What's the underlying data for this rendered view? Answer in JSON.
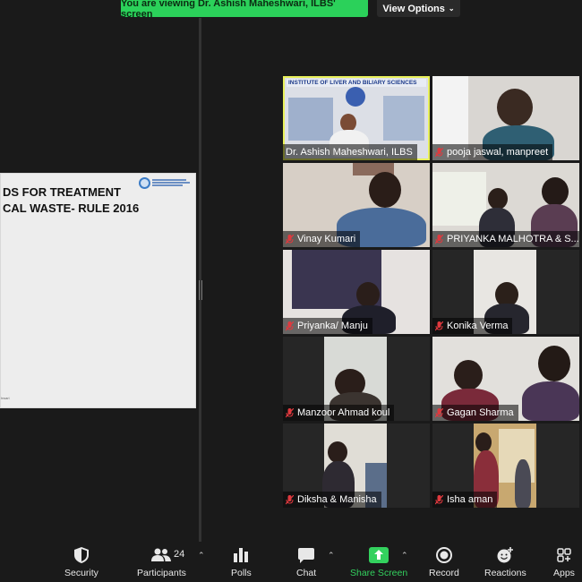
{
  "banner": {
    "text": "You are viewing Dr. Ashish Maheshwari, ILBS' screen"
  },
  "view_options": {
    "label": "View Options"
  },
  "slide": {
    "title_line1": "DS FOR TREATMENT",
    "title_line2": "CAL WASTE- RULE 2016",
    "logo_text": "WHO Collaborating Centre on Viral Hepatitis & Liver Diseases",
    "footer": "hwari"
  },
  "presenter_banner": {
    "text": "INSTITUTE OF LIVER AND BILIARY SCIENCES"
  },
  "participants_tiles": [
    {
      "name": "Dr. Ashish Maheshwari, ILBS",
      "muted": false
    },
    {
      "name": "pooja jaswal, manpreet",
      "muted": true
    },
    {
      "name": "Vinay Kumari",
      "muted": true
    },
    {
      "name": "PRIYANKA MALHOTRA & S...",
      "muted": true
    },
    {
      "name": "Priyanka/ Manju",
      "muted": true
    },
    {
      "name": "Konika Verma",
      "muted": true
    },
    {
      "name": "Manzoor Ahmad koul",
      "muted": true
    },
    {
      "name": "Gagan Sharma",
      "muted": true
    },
    {
      "name": "Diksha & Manisha",
      "muted": true
    },
    {
      "name": "Isha  aman",
      "muted": true
    }
  ],
  "toolbar": {
    "security": "Security",
    "participants": "Participants",
    "participants_count": "24",
    "polls": "Polls",
    "chat": "Chat",
    "share_screen": "Share Screen",
    "record": "Record",
    "reactions": "Reactions",
    "apps": "Apps"
  },
  "colors": {
    "active_speaker": "#e8f05a",
    "share_green": "#33d15e",
    "banner_green": "#2bd15a",
    "muted_red": "#e0393e"
  }
}
